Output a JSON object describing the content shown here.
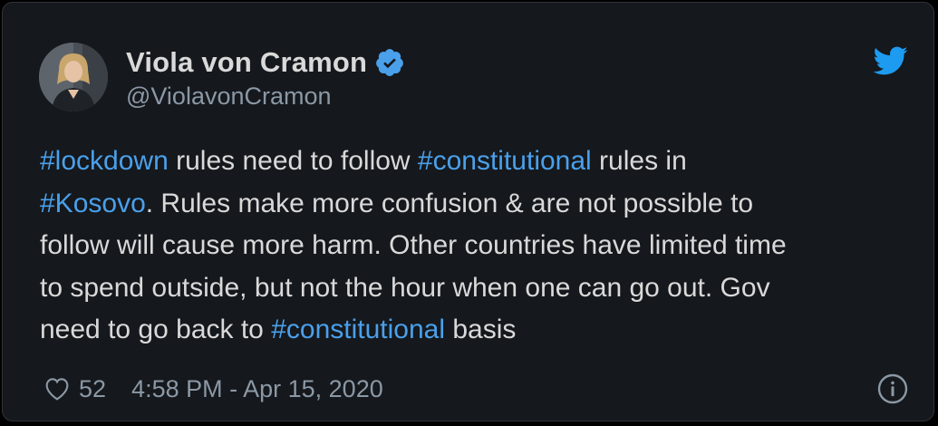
{
  "author": {
    "name": "Viola von Cramon",
    "handle": "@ViolavonCramon",
    "verified": true,
    "verified_icon": "verified-badge-icon",
    "avatar_icon": "avatar"
  },
  "brand": {
    "logo_icon": "twitter-bird-icon",
    "color": "#1d9bf0"
  },
  "tweet": {
    "lines": [
      [
        {
          "text": "#lockdown",
          "hashtag": true
        },
        {
          "text": " rules need to follow ",
          "hashtag": false
        },
        {
          "text": "#constitutional",
          "hashtag": true
        },
        {
          "text": " rules in",
          "hashtag": false
        }
      ],
      [
        {
          "text": "#Kosovo",
          "hashtag": true
        },
        {
          "text": ". Rules make more confusion & are not possible to",
          "hashtag": false
        }
      ],
      [
        {
          "text": "follow will cause more harm. Other countries have limited time",
          "hashtag": false
        }
      ],
      [
        {
          "text": "to spend outside, but not the hour when one can go out. Gov",
          "hashtag": false
        }
      ],
      [
        {
          "text": "need to go back to ",
          "hashtag": false
        },
        {
          "text": "#constitutional",
          "hashtag": true
        },
        {
          "text": " basis",
          "hashtag": false
        }
      ]
    ]
  },
  "footer": {
    "like_icon": "heart-icon",
    "like_count": "52",
    "timestamp": "4:58 PM - Apr 15, 2020",
    "info_icon": "info-icon"
  },
  "colors": {
    "background": "#15181c",
    "text": "#d9d9d9",
    "secondary_text": "#8b98a5",
    "hashtag": "#4aa0eb"
  }
}
